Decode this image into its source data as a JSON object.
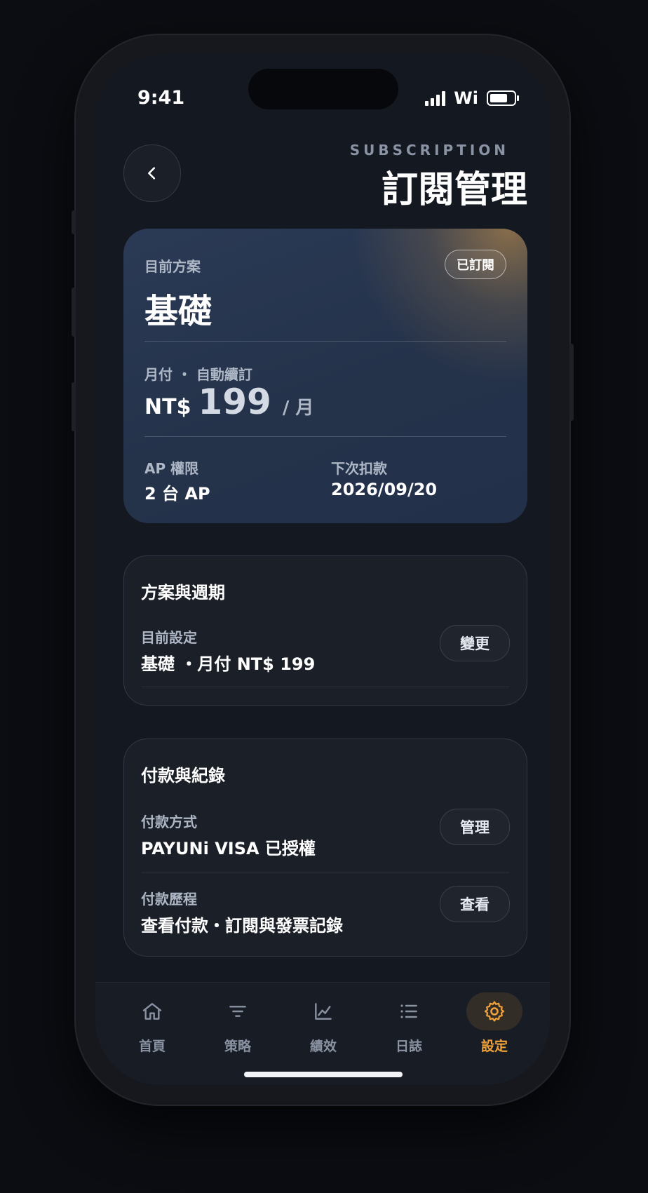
{
  "status_bar": {
    "time": "9:41",
    "wifi": "Wi"
  },
  "header": {
    "eyebrow": "SUBSCRIPTION",
    "title": "訂閱管理"
  },
  "plan_card": {
    "label": "目前方案",
    "badge": "已訂閱",
    "plan_name": "基礎",
    "billing_label": "月付 ・ 自動續訂",
    "currency": "NT$",
    "amount": "199",
    "unit": "/ 月",
    "ap_label": "AP 權限",
    "ap_value": "2 台 AP",
    "next_label": "下次扣款",
    "next_value": "2026/09/20",
    "accent_color": "#d69a48"
  },
  "plan_section": {
    "title": "方案與週期",
    "row_label": "目前設定",
    "row_value": "基礎 ・月付 NT$ 199",
    "button": "變更"
  },
  "payment_section": {
    "title": "付款與紀錄",
    "rows": [
      {
        "label": "付款方式",
        "value": "PAYUNi VISA 已授權",
        "button": "管理"
      },
      {
        "label": "付款歷程",
        "value": "查看付款・訂閱與發票記錄",
        "button": "查看"
      }
    ]
  },
  "tab_bar": {
    "items": [
      {
        "label": "首頁",
        "icon": "home-icon"
      },
      {
        "label": "策略",
        "icon": "filter-icon"
      },
      {
        "label": "績效",
        "icon": "chart-line-icon"
      },
      {
        "label": "日誌",
        "icon": "list-icon"
      },
      {
        "label": "設定",
        "icon": "gear-icon",
        "active": true
      }
    ],
    "active_color": "#f0a23b"
  }
}
